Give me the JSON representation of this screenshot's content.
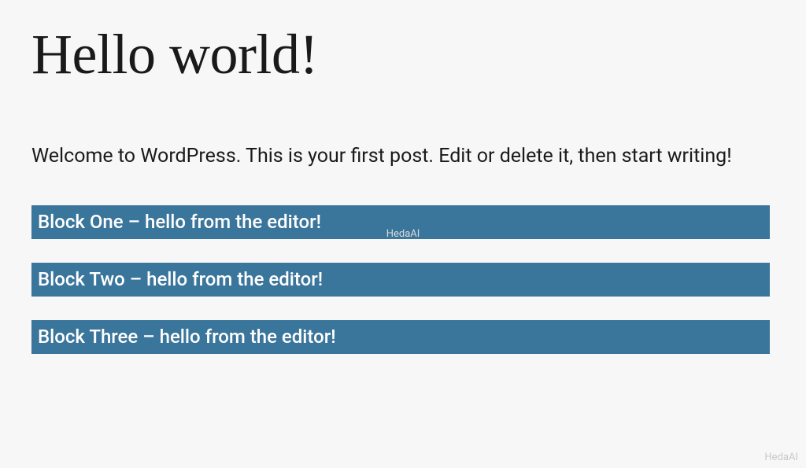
{
  "post": {
    "title": "Hello world!",
    "intro": "Welcome to WordPress. This is your first post. Edit or delete it, then start writing!"
  },
  "blocks": {
    "one": "Block One – hello from the editor!",
    "two": "Block Two – hello from the editor!",
    "three": "Block Three – hello from the editor!"
  },
  "watermark": {
    "center": "HedaAI",
    "corner": "HedaAI"
  }
}
